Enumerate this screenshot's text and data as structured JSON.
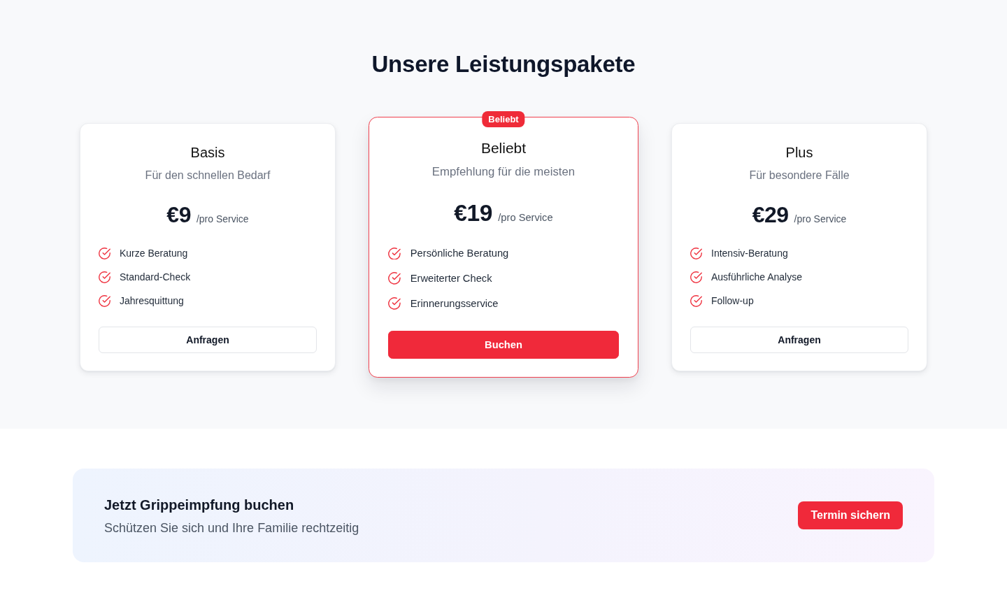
{
  "pricing": {
    "title": "Unsere Leistungspakete",
    "plans": [
      {
        "name": "Basis",
        "subtitle": "Für den schnellen Bedarf",
        "price": "€9",
        "unit": "/pro Service",
        "features": [
          "Kurze Beratung",
          "Standard-Check",
          "Jahresquittung"
        ],
        "button": "Anfragen",
        "featured": false
      },
      {
        "badge": "Beliebt",
        "name": "Beliebt",
        "subtitle": "Empfehlung für die meisten",
        "price": "€19",
        "unit": "/pro Service",
        "features": [
          "Persönliche Beratung",
          "Erweiterter Check",
          "Erinnerungsservice"
        ],
        "button": "Buchen",
        "featured": true
      },
      {
        "name": "Plus",
        "subtitle": "Für besondere Fälle",
        "price": "€29",
        "unit": "/pro Service",
        "features": [
          "Intensiv-Beratung",
          "Ausführliche Analyse",
          "Follow-up"
        ],
        "button": "Anfragen",
        "featured": false
      }
    ]
  },
  "cta": {
    "title": "Jetzt Grippeimpfung buchen",
    "subtitle": "Schützen Sie sich und Ihre Familie rechtzeitig",
    "button": "Termin sichern"
  }
}
